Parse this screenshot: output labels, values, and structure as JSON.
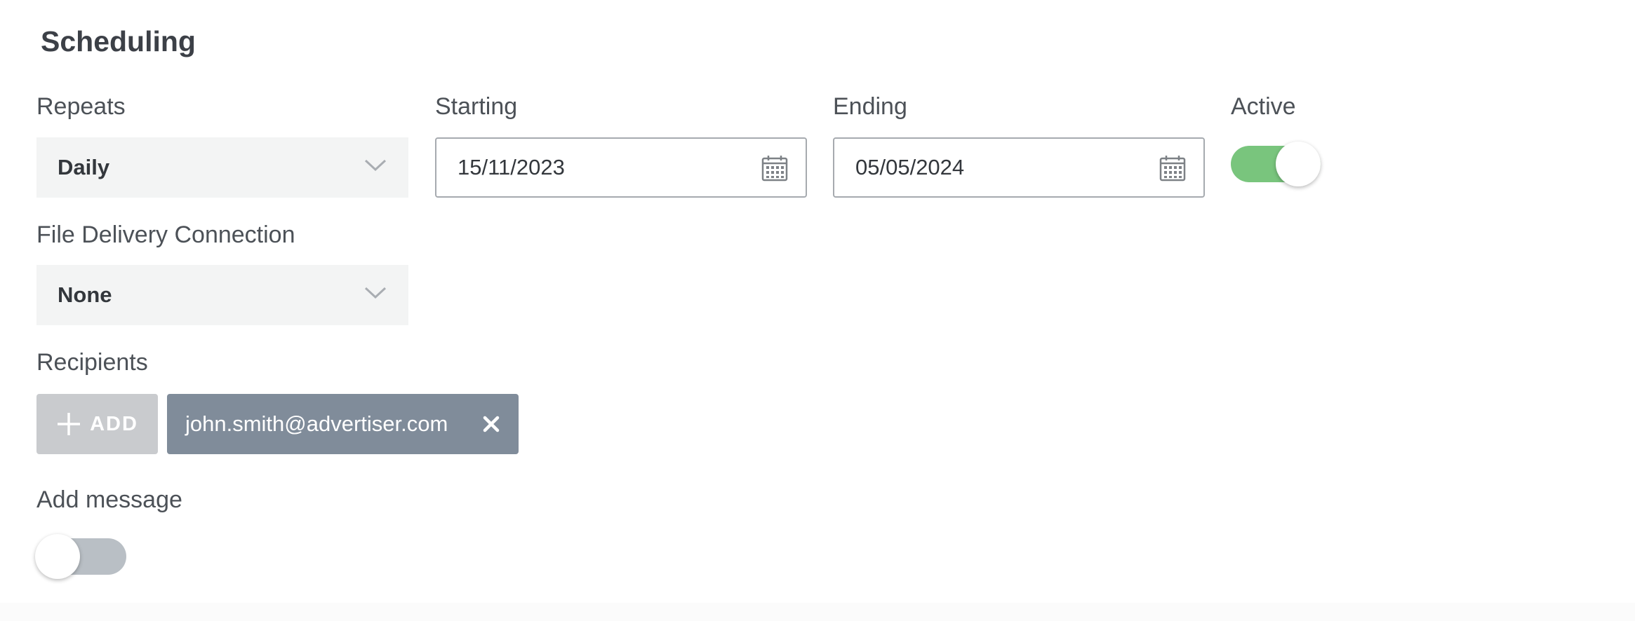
{
  "section": {
    "title": "Scheduling"
  },
  "repeats": {
    "label": "Repeats",
    "value": "Daily"
  },
  "starting": {
    "label": "Starting",
    "value": "15/11/2023"
  },
  "ending": {
    "label": "Ending",
    "value": "05/05/2024"
  },
  "active": {
    "label": "Active",
    "on": true
  },
  "file_delivery": {
    "label": "File Delivery Connection",
    "value": "None"
  },
  "recipients": {
    "label": "Recipients",
    "add_label": "ADD",
    "chips": [
      "john.smith@advertiser.com"
    ]
  },
  "message": {
    "label": "Add message",
    "on": false
  },
  "colors": {
    "toggle_on": "#79c57d",
    "toggle_off": "#b9bfc5",
    "chip_bg": "#808c9a",
    "add_button_bg": "#c9cbce"
  }
}
